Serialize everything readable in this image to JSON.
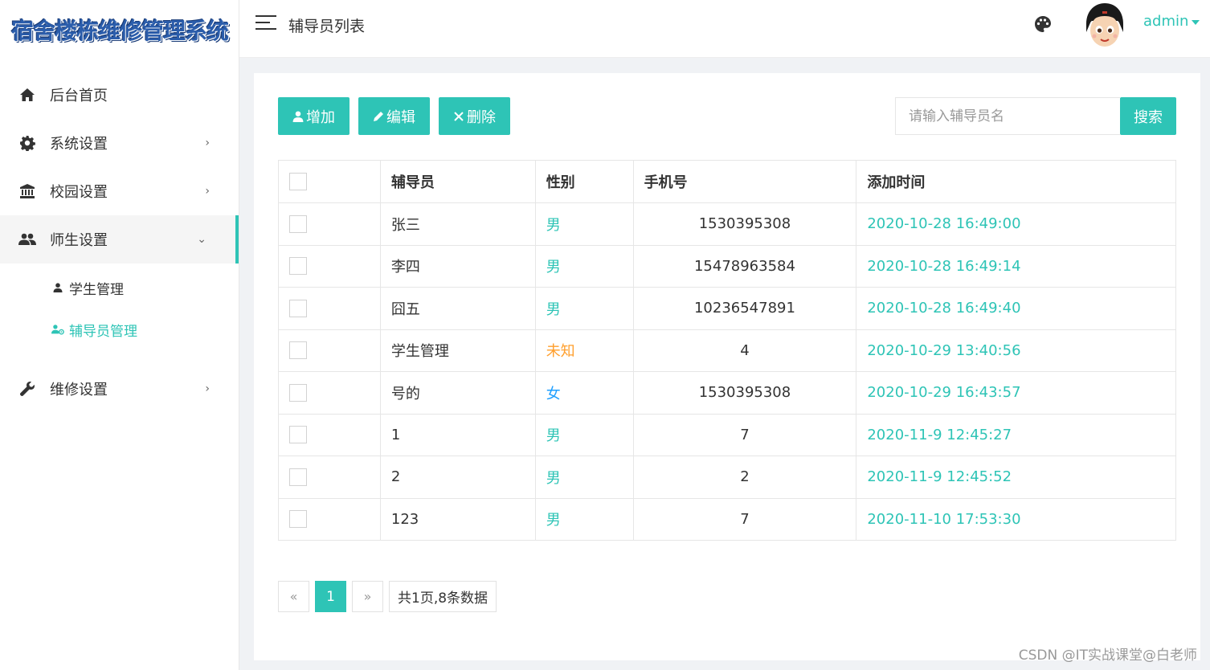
{
  "app": {
    "logo_text": "宿舍楼栋维修管理系统"
  },
  "header": {
    "title": "辅导员列表",
    "username": "admin"
  },
  "sidebar": {
    "items": [
      {
        "label": "后台首页",
        "icon": "home-icon"
      },
      {
        "label": "系统设置",
        "icon": "gear-icon"
      },
      {
        "label": "校园设置",
        "icon": "bank-icon"
      },
      {
        "label": "师生设置",
        "icon": "users-icon"
      },
      {
        "label": "维修设置",
        "icon": "wrench-icon"
      }
    ],
    "subitems": [
      {
        "label": "学生管理",
        "icon": "user-icon"
      },
      {
        "label": "辅导员管理",
        "icon": "user-gear-icon"
      }
    ]
  },
  "toolbar": {
    "add_label": "增加",
    "edit_label": "编辑",
    "delete_label": "删除",
    "search_placeholder": "请输入辅导员名",
    "search_label": "搜索"
  },
  "table": {
    "headers": [
      "辅导员",
      "性别",
      "手机号",
      "添加时间"
    ],
    "rows": [
      {
        "name": "张三",
        "sex": "男",
        "phone": "1530395308",
        "time": "2020-10-28 16:49:00"
      },
      {
        "name": "李四",
        "sex": "男",
        "phone": "15478963584",
        "time": "2020-10-28 16:49:14"
      },
      {
        "name": "囧五",
        "sex": "男",
        "phone": "10236547891",
        "time": "2020-10-28 16:49:40"
      },
      {
        "name": "学生管理",
        "sex": "未知",
        "phone": "4",
        "time": "2020-10-29 13:40:56"
      },
      {
        "name": "号的",
        "sex": "女",
        "phone": "1530395308",
        "time": "2020-10-29 16:43:57"
      },
      {
        "name": "1",
        "sex": "男",
        "phone": "7",
        "time": "2020-11-9 12:45:27"
      },
      {
        "name": "2",
        "sex": "男",
        "phone": "2",
        "time": "2020-11-9 12:45:52"
      },
      {
        "name": "123",
        "sex": "男",
        "phone": "7",
        "time": "2020-11-10 17:53:30"
      }
    ]
  },
  "pagination": {
    "prev": "«",
    "current": "1",
    "next": "»",
    "summary": "共1页,8条数据"
  },
  "watermark": "CSDN @IT实战课堂@白老师",
  "colors": {
    "accent": "#2ec4b6",
    "unknown_sex": "#ff9f2d",
    "female": "#1e9fff"
  }
}
